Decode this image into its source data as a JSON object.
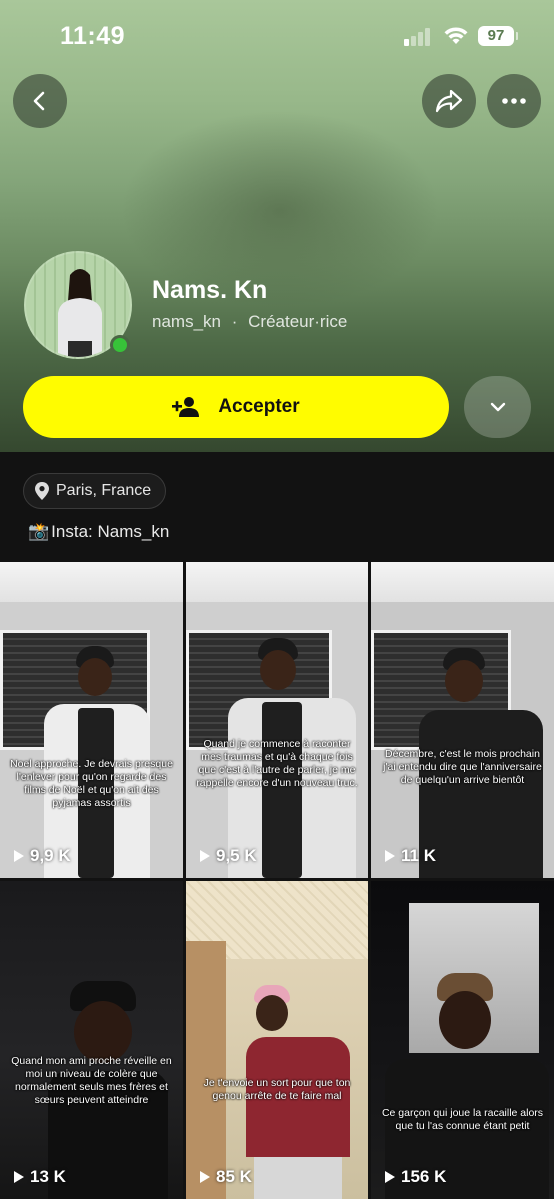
{
  "status_bar": {
    "time": "11:49",
    "battery": "97"
  },
  "nav": {
    "back_icon": "chevron-left-icon",
    "share_icon": "share-arrow-icon",
    "more_icon": "more-dots-icon"
  },
  "profile": {
    "name": "Nams. Kn",
    "username": "nams_kn",
    "separator": "·",
    "role": "Créateur·rice",
    "online_color": "#37c239"
  },
  "actions": {
    "accept_label": "Accepter",
    "accept_icon": "add-friend-icon",
    "accept_color": "#fffc00",
    "dropdown_icon": "chevron-down-icon"
  },
  "info": {
    "location": "Paris, France",
    "location_icon": "location-pin-icon",
    "bio_emoji": "📸",
    "bio_text": "Insta: Nams_kn"
  },
  "videos": [
    {
      "caption": "Noel approche. Je devrais presque l'enlever pour qu'on regarde des films de Noël et qu'on ait des pyjamas assortis",
      "views": "9,9 K"
    },
    {
      "caption": "Quand je commence à raconter mes traumas et qu'à chaque fois que c'est à l'autre de parler, je me rappelle encore d'un nouveau truc.",
      "views": "9,5 K"
    },
    {
      "caption": "Décembre, c'est le mois prochain j'ai entendu dire que l'anniversaire de quelqu'un arrive bientôt",
      "views": "11 K"
    },
    {
      "caption": "Quand mon ami proche réveille en moi un niveau de colère que normalement seuls mes frères et sœurs peuvent atteindre",
      "views": "13 K"
    },
    {
      "caption": "Je t'envoie un sort pour que ton genou arrête de te faire mal",
      "views": "85 K"
    },
    {
      "caption": "Ce garçon qui joue la racaille alors que tu l'as connue étant petit",
      "views": "156 K"
    }
  ]
}
